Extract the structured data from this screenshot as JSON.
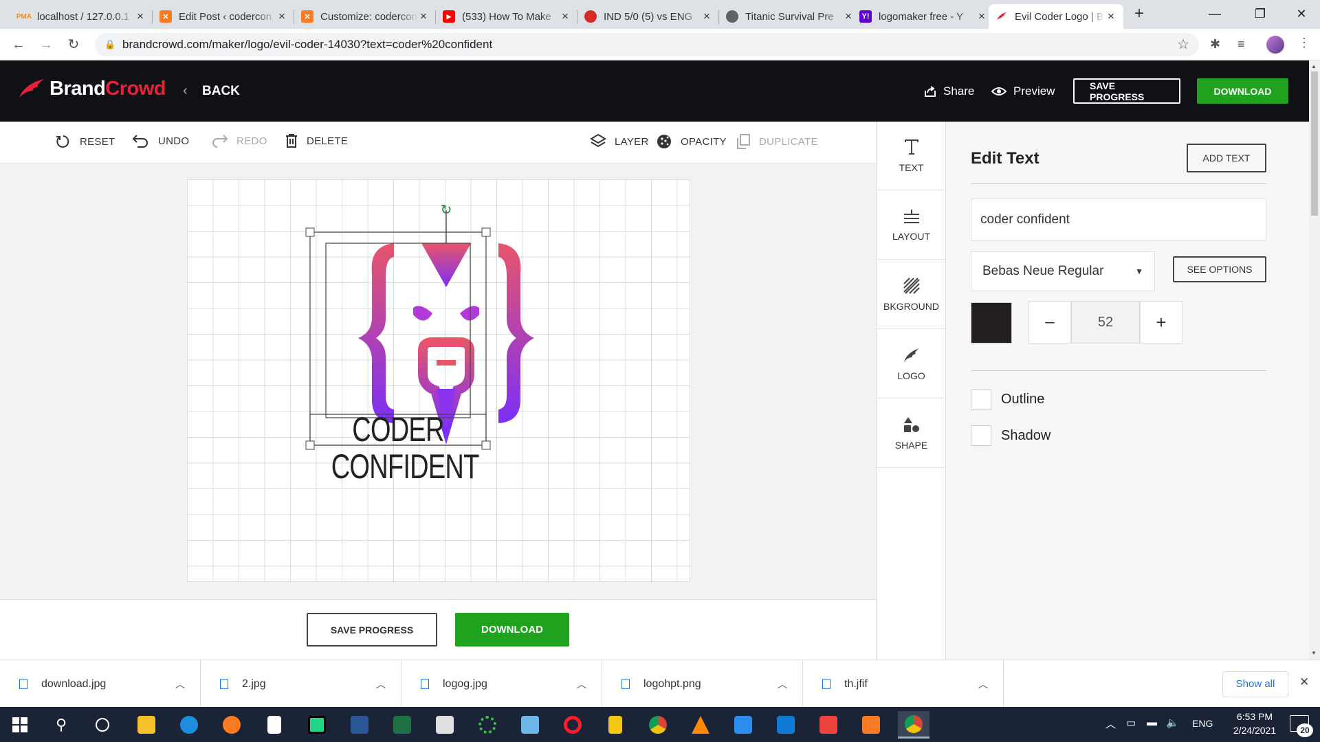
{
  "browser": {
    "tabs": [
      {
        "title": "localhost / 127.0.0.1",
        "close": "×",
        "icon": "phpmyadmin-icon",
        "color": "#f29111"
      },
      {
        "title": "Edit Post ‹ codercon",
        "close": "×",
        "icon": "xampp-icon",
        "color": "#fb7a24"
      },
      {
        "title": "Customize: codercon",
        "close": "×",
        "icon": "xampp-icon",
        "color": "#fb7a24"
      },
      {
        "title": "(533) How To Make",
        "close": "×",
        "icon": "youtube-icon",
        "color": "#ff0000"
      },
      {
        "title": "IND 5/0 (5) vs ENG",
        "close": "×",
        "icon": "cricket-icon",
        "color": "#d62b2b"
      },
      {
        "title": "Titanic Survival Pre",
        "close": "×",
        "icon": "globe-icon",
        "color": "#5f6368"
      },
      {
        "title": "logomaker free - Y",
        "close": "×",
        "icon": "yahoo-icon",
        "color": "#6001d2"
      },
      {
        "title": "Evil Coder Logo | B",
        "close": "×",
        "icon": "brandcrowd-icon",
        "color": "#e8203a"
      }
    ],
    "new_tab": "+",
    "url": "brandcrowd.com/maker/logo/evil-coder-14030?text=coder%20confident",
    "window_controls": {
      "minimize": "—",
      "maximize": "❐",
      "close": "✕"
    }
  },
  "header": {
    "brand_part1": "Brand",
    "brand_part2": "Crowd",
    "back": "BACK",
    "share": "Share",
    "preview": "Preview",
    "save_progress": "SAVE PROGRESS",
    "download": "DOWNLOAD"
  },
  "toolbar": {
    "reset": "RESET",
    "undo": "UNDO",
    "redo": "REDO",
    "delete": "DELETE",
    "layer": "LAYER",
    "opacity": "OPACITY",
    "duplicate": "DUPLICATE"
  },
  "canvas": {
    "logo_text": "CODER CONFIDENT"
  },
  "bottom": {
    "save_progress": "SAVE PROGRESS",
    "download": "DOWNLOAD"
  },
  "sidenav": {
    "text": "TEXT",
    "layout": "LAYOUT",
    "background": "BKGROUND",
    "logo": "LOGO",
    "shape": "SHAPE"
  },
  "panel": {
    "title": "Edit Text",
    "add_text": "ADD TEXT",
    "text_value": "coder confident",
    "font": "Bebas Neue Regular",
    "see_options": "SEE OPTIONS",
    "color": "#231f20",
    "size_minus": "–",
    "font_size": "52",
    "size_plus": "+",
    "outline": "Outline",
    "shadow": "Shadow"
  },
  "downloads": {
    "items": [
      "download.jpg",
      "2.jpg",
      "logog.jpg",
      "logohpt.png",
      "th.jfif"
    ],
    "show_all": "Show all",
    "close": "✕"
  },
  "taskbar": {
    "language": "ENG",
    "time": "6:53 PM",
    "date": "2/24/2021",
    "notifications": "20"
  },
  "colors": {
    "brand_red": "#e8203a",
    "green": "#1fa31f",
    "header_bg": "#0f1114",
    "logo_gradient_top": "#e8556b",
    "logo_gradient_bottom": "#7b2ff7"
  }
}
